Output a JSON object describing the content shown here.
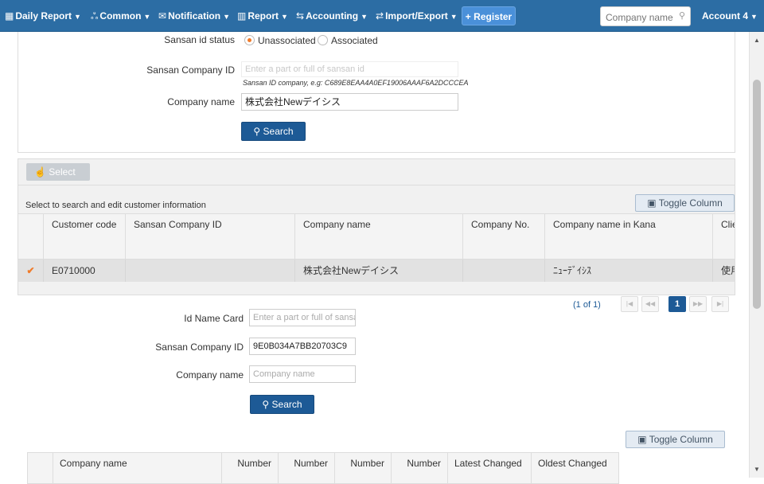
{
  "navbar": {
    "items": [
      {
        "icon": "calendar-icon",
        "glyph": "▦",
        "label": "Daily Report"
      },
      {
        "icon": "users-icon",
        "glyph": "ஃ",
        "label": "Common"
      },
      {
        "icon": "envelope-icon",
        "glyph": "✉",
        "label": "Notification"
      },
      {
        "icon": "bar-chart-icon",
        "glyph": "▥",
        "label": "Report"
      },
      {
        "icon": "exchange-icon",
        "glyph": "⇆",
        "label": "Accounting"
      },
      {
        "icon": "import-export-icon",
        "glyph": "⇄",
        "label": "Import/Export"
      }
    ],
    "register_label": "Register",
    "register_glyph": "+",
    "search_placeholder": "Company name",
    "account_label": "Account 4"
  },
  "top_form": {
    "status_label": "Sansan id status",
    "status_options": [
      "Unassociated",
      "Associated"
    ],
    "status_selected": "Unassociated",
    "sansan_id_label": "Sansan Company ID",
    "sansan_id_placeholder": "Enter a part or full of sansan id",
    "sansan_id_hint": "Sansan ID company, e.g: C689E8EAA4A0EF19006AAAF6A2DCCCEA",
    "company_name_label": "Company name",
    "company_name_value": "株式会社Newデイシス",
    "search_label": "Search"
  },
  "customer_grid": {
    "select_label": "Select",
    "caption": "Select to search and edit customer information",
    "toggle_label": "Toggle Column",
    "columns": [
      "Customer code",
      "Sansan Company ID",
      "Company name",
      "Company No.",
      "Company name in Kana",
      "Clie"
    ],
    "rows": [
      {
        "checked": true,
        "customer_code": "E0710000",
        "sansan_id": "",
        "company_name": "株式会社Newデイシス",
        "company_no": "",
        "kana": "ﾆｭｰﾃﾞｲｼｽ",
        "client": "使用"
      }
    ]
  },
  "pager": {
    "info": "(1 of 1)",
    "first": "|◀",
    "prev": "◀◀",
    "current": "1",
    "next": "▶▶",
    "last": "▶|"
  },
  "namecard_form": {
    "id_label": "Id Name Card",
    "id_placeholder": "Enter a part or full of sansan id",
    "sansan_id_label": "Sansan Company ID",
    "sansan_id_value": "9E0B034A7BB20703C9",
    "company_label": "Company name",
    "company_placeholder": "Company name",
    "search_label": "Search"
  },
  "bottom_grid": {
    "toggle_label": "Toggle Column",
    "columns": [
      "Company name",
      "Number",
      "Number",
      "Number",
      "Number",
      "Latest Changed",
      "Oldest Changed"
    ]
  }
}
